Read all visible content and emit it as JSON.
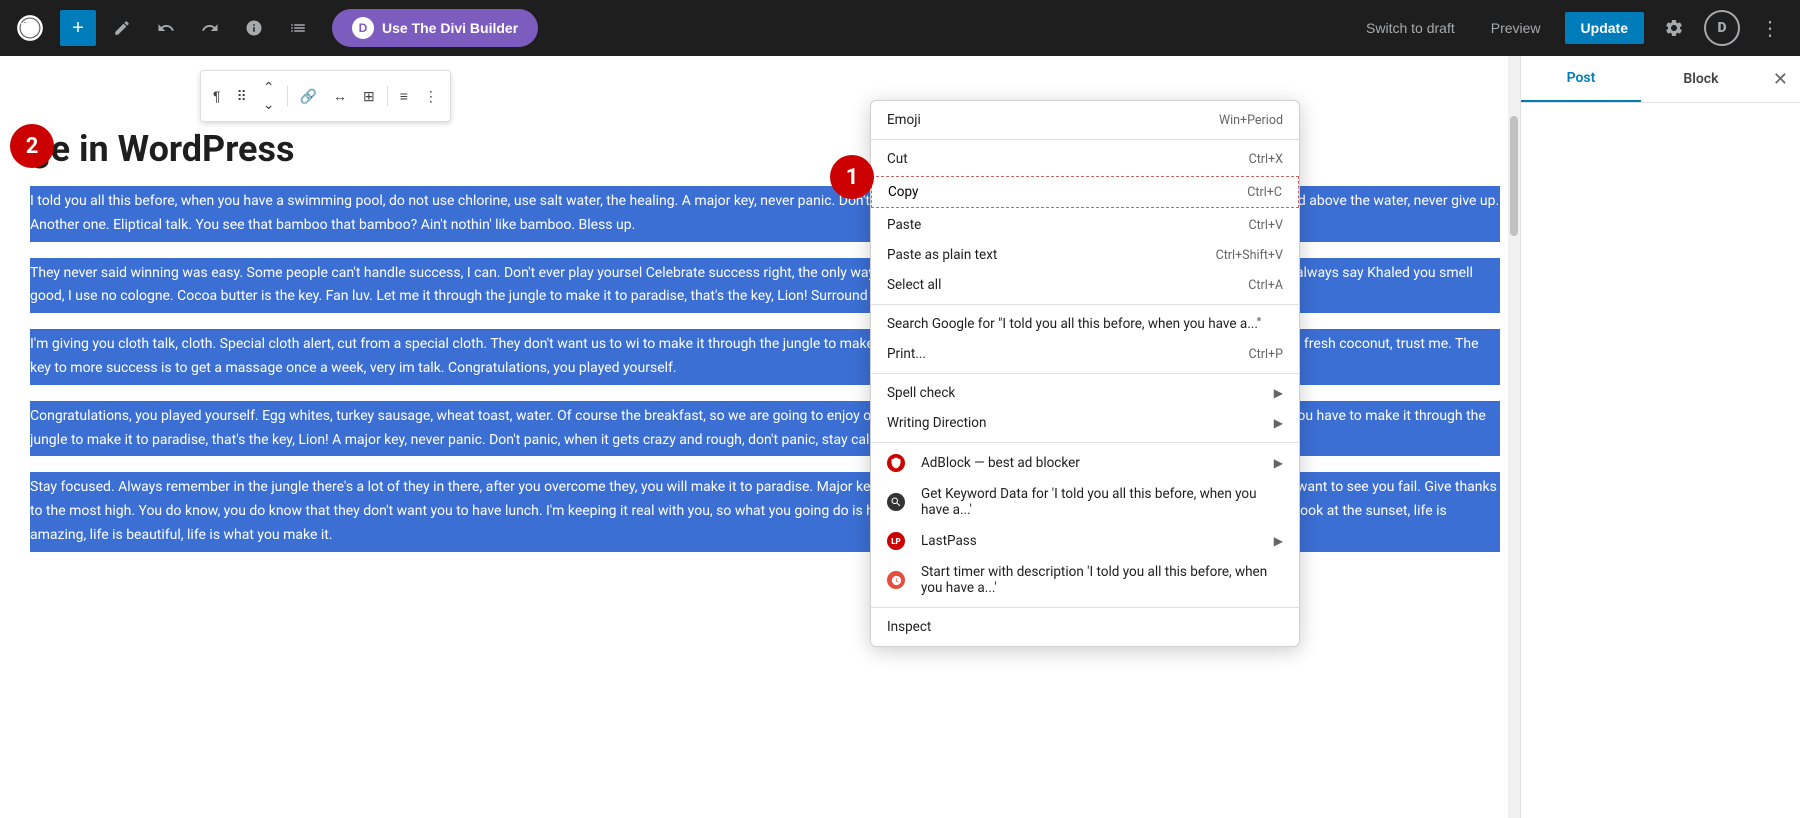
{
  "topbar": {
    "add_label": "+",
    "divi_label": "Use The Divi Builder",
    "switch_draft": "Switch to draft",
    "preview": "Preview",
    "update": "Update",
    "divi_letter": "D"
  },
  "tabs": {
    "post": "Post",
    "block": "Block"
  },
  "page": {
    "title": "ge in WordPress"
  },
  "paragraphs": [
    "I told you all this before, when you have a swimming pool, do not use chlorine, use salt water, the healing. A major key, never panic. Don't panic, when it gets crazy and rough, don't panic, stay c keep your head above the water, never give up. Another one. Eliptical talk. You see that bamboo that bamboo? Ain't nothin' like bamboo. Bless up.",
    "They never said winning was easy. Some people can't handle success, I can. Don't ever play yoursel Celebrate success right, the only way, apple. They never said winning was easy. Some people can't ladies always say Khaled you smell good, I use no cologne. Cocoa butter is the key. Fan luv. Let me it through the jungle to make it to paradise, that's the key, Lion! Surround yourself with angels. Lio",
    "I'm giving you cloth talk, cloth. Special cloth alert, cut from a special cloth. They don't want us to wi to make it through the jungle to make it to paradise, that's the key, Lion! Special cloth alert. Wraith coconut, fresh coconut, trust me. The key to more success is to get a massage once a week, very im talk. Congratulations, you played yourself.",
    "Congratulations, you played yourself. Egg whites, turkey sausage, wheat toast, water. Of course the breakfast, so we are going to enjoy our breakfast. Give thanks to the most high. You smart, you loy clear, you have to make it through the jungle to make it to paradise, that's the key, Lion! A major key, never panic. Don't panic, when it gets crazy and rough, don't panic, stay calm. Mogul talk.",
    "Stay focused. Always remember in the jungle there's a lot of they in there, after you overcome they, you will make it to paradise. Major key, don't fall for the trap, stay focused. It's the ones closest to you that want to see you fail. Give thanks to the most high. You do know, you do know that they don't want you to have lunch. I'm keeping it real with you, so what you going do is have lunch. They key is to have every key, the key to open every door. Look at the sunset, life is amazing, life is beautiful, life is what you make it."
  ],
  "context_menu": {
    "emoji": "Emoji",
    "emoji_shortcut": "Win+Period",
    "cut": "Cut",
    "cut_shortcut": "Ctrl+X",
    "copy": "Copy",
    "copy_shortcut": "Ctrl+C",
    "paste": "Paste",
    "paste_shortcut": "Ctrl+V",
    "paste_plain": "Paste as plain text",
    "paste_plain_shortcut": "Ctrl+Shift+V",
    "select_all": "Select all",
    "select_all_shortcut": "Ctrl+A",
    "search_google": "Search Google for \"I told you all this before, when you have a...\"",
    "print": "Print...",
    "print_shortcut": "Ctrl+P",
    "spell_check": "Spell check",
    "writing_direction": "Writing Direction",
    "adblock": "AdBlock — best ad blocker",
    "keyword_data": "Get Keyword Data for 'I told you all this before, when you have a...'",
    "lastpass": "LastPass",
    "start_timer": "Start timer with description 'I told you all this before, when you have a...'",
    "inspect": "Inspect"
  },
  "badges": {
    "b1": "1",
    "b2": "2"
  }
}
